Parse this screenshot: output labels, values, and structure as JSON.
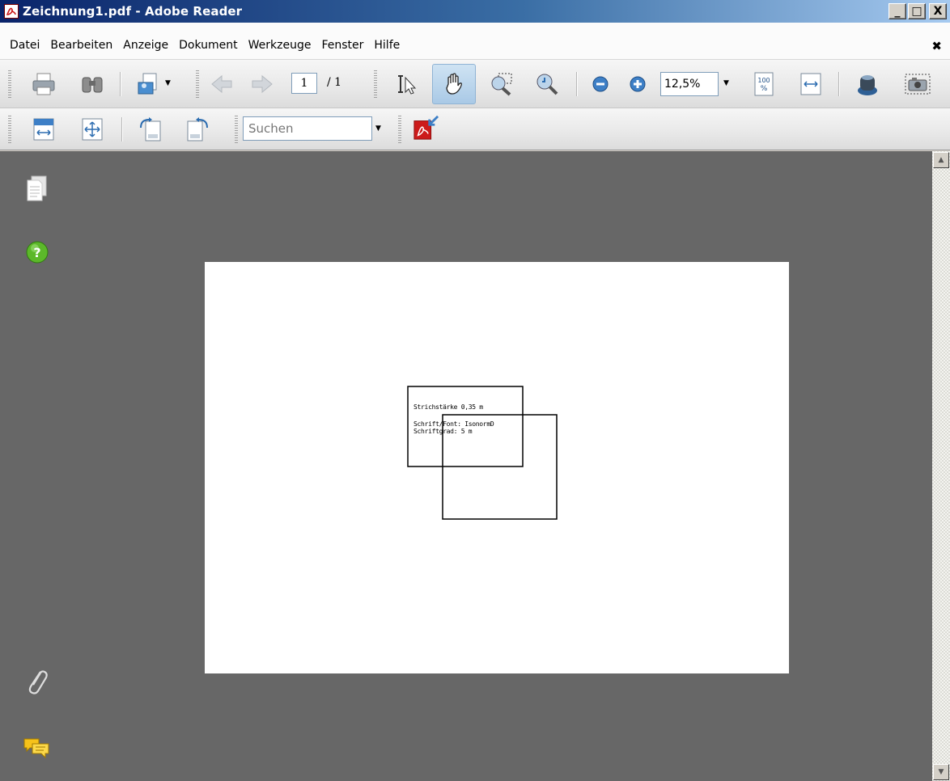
{
  "window": {
    "title": "Zeichnung1.pdf - Adobe Reader",
    "minimize_glyph": "_",
    "maximize_glyph": "□",
    "close_glyph": "X"
  },
  "menu": {
    "items": [
      "Datei",
      "Bearbeiten",
      "Anzeige",
      "Dokument",
      "Werkzeuge",
      "Fenster",
      "Hilfe"
    ],
    "close_glyph": "✖"
  },
  "toolbar": {
    "page_current": "1",
    "page_total": "/ 1",
    "zoom": "12,5%",
    "search_placeholder": "Suchen",
    "dropdown_glyph": "▼",
    "actual_size_label": "100\n%"
  },
  "document": {
    "line1": "Strichstärke 0,35 m",
    "line2": "Schrift/Font: IsonormD",
    "line3": "Schriftgrad: 5 m"
  },
  "scrollbar": {
    "up_glyph": "▲",
    "down_glyph": "▼"
  },
  "colors": {
    "titlebar_start": "#0a246a",
    "workspace": "#676767",
    "toolbar": "#e8e8e8",
    "acrobat_red": "#cc1b1b"
  }
}
